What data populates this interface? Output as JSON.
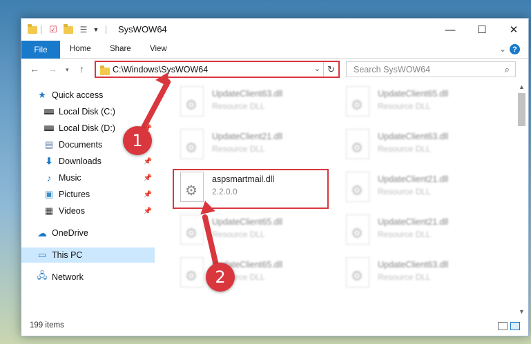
{
  "window": {
    "title": "SysWOW64",
    "controls": [
      "—",
      "☐",
      "✕"
    ]
  },
  "ribbon": {
    "tabs": [
      "File",
      "Home",
      "Share",
      "View"
    ]
  },
  "navigation": {
    "address_path": "C:\\Windows\\SysWOW64",
    "search_placeholder": "Search SysWOW64"
  },
  "sidebar": {
    "items": [
      {
        "label": "Quick access",
        "icon": "star-icon"
      },
      {
        "label": "Local Disk (C:)",
        "icon": "drive-icon"
      },
      {
        "label": "Local Disk (D:)",
        "icon": "drive-icon",
        "pinned": true
      },
      {
        "label": "Documents",
        "icon": "documents-icon",
        "pinned": true
      },
      {
        "label": "Downloads",
        "icon": "download-icon",
        "pinned": true
      },
      {
        "label": "Music",
        "icon": "music-icon",
        "pinned": true
      },
      {
        "label": "Pictures",
        "icon": "pictures-icon",
        "pinned": true
      },
      {
        "label": "Videos",
        "icon": "videos-icon",
        "pinned": true
      },
      {
        "label": "OneDrive",
        "icon": "onedrive-icon"
      },
      {
        "label": "This PC",
        "icon": "computer-icon",
        "selected": true
      },
      {
        "label": "Network",
        "icon": "network-icon"
      }
    ]
  },
  "files": [
    {
      "name": "UpdateClient63.dll",
      "sub": "Resource DLL",
      "blurred": true
    },
    {
      "name": "UpdateClient65.dll",
      "sub": "Resource DLL",
      "blurred": true
    },
    {
      "name": "UpdateClient21.dll",
      "sub": "Resource DLL",
      "blurred": true
    },
    {
      "name": "UpdateClient63.dll",
      "sub": "Resource DLL",
      "blurred": true
    },
    {
      "name": "aspsmartmail.dll",
      "sub": "2.2.0.0",
      "blurred": false
    },
    {
      "name": "UpdateClient21.dll",
      "sub": "Resource DLL",
      "blurred": true
    },
    {
      "name": "UpdateClient65.dll",
      "sub": "Resource DLL",
      "blurred": true
    },
    {
      "name": "UpdateClient21.dll",
      "sub": "Resource DLL",
      "blurred": true
    },
    {
      "name": "UpdateClient65.dll",
      "sub": "Resource DLL",
      "blurred": true
    },
    {
      "name": "UpdateClient63.dll",
      "sub": "Resource DLL",
      "blurred": true
    }
  ],
  "status": {
    "item_count": "199 items"
  },
  "annotations": {
    "callout_1": "1",
    "callout_2": "2",
    "color": "#d9363e"
  }
}
